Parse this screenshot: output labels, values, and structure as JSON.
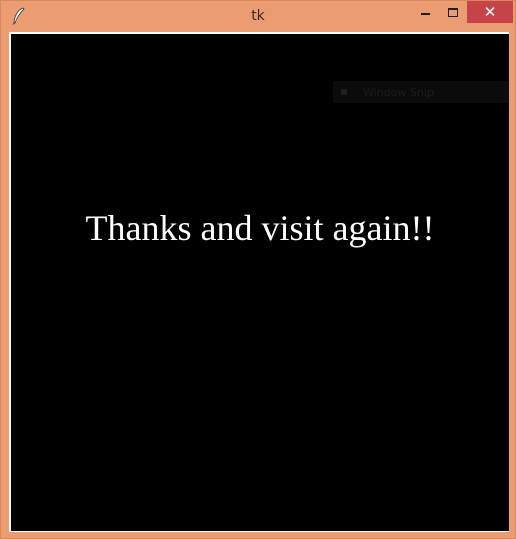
{
  "window": {
    "title": "tk",
    "app_icon": "feather-icon",
    "close_label": "✕"
  },
  "ghost_overlay": {
    "label": "Window Snip"
  },
  "canvas": {
    "message": "Thanks and visit again!!"
  },
  "colors": {
    "titlebar": "#ec9c71",
    "close_button": "#c7434a",
    "canvas": "#000000",
    "message_text": "#ffffff"
  }
}
